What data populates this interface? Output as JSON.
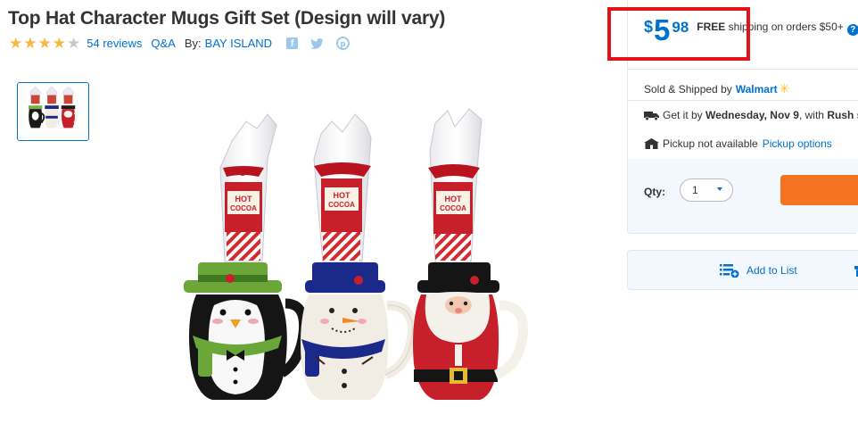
{
  "product": {
    "title": "Top Hat Character Mugs Gift Set (Design will vary)",
    "rating": 4,
    "rating_max": 5,
    "reviews_label": "54 reviews",
    "qa_label": "Q&A",
    "by_label": "By:",
    "brand": "BAY ISLAND"
  },
  "social": {
    "facebook_icon": "facebook-icon",
    "twitter_icon": "twitter-icon",
    "pinterest_icon": "pinterest-icon"
  },
  "price": {
    "currency": "$",
    "whole": "5",
    "cents": "98",
    "shipping_bold": "FREE",
    "shipping_rest": "shipping on orders $50+",
    "help_glyph": "?"
  },
  "fulfillment": {
    "sold_label": "Sold & Shipped by",
    "seller": "Walmart",
    "delivery_prefix": "Get it by",
    "delivery_date": "Wednesday, Nov 9",
    "delivery_mid": ", with",
    "delivery_method": "Rush",
    "delivery_suffix": "sh",
    "pickup_text": "Pickup not available",
    "pickup_link": "Pickup options"
  },
  "cart": {
    "qty_label": "Qty:",
    "qty_value": "1"
  },
  "list": {
    "add_label": "Add to List"
  },
  "image_labels": {
    "mug_text_1": "HOT",
    "mug_text_2": "COCOA"
  },
  "colors": {
    "accent": "#0071ce",
    "star": "#f8b83b",
    "cart": "#f47321",
    "highlight": "#e6121a",
    "walmart_spark": "#ffc220"
  }
}
